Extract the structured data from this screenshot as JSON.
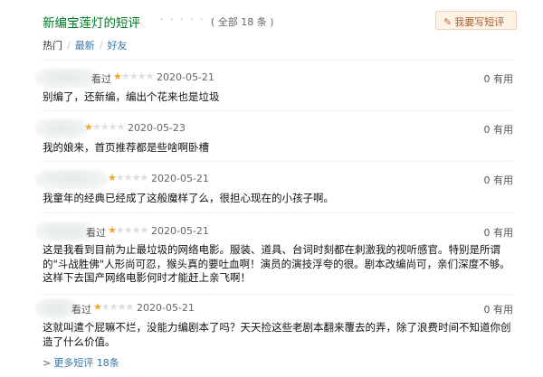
{
  "header": {
    "title": "新编宝莲灯的短评",
    "dots": "· · · · · ·",
    "count": "( 全部 18 条 )",
    "write_button": "我要写短评"
  },
  "filters": {
    "hot": "热门",
    "sep": "/",
    "latest": "最新",
    "friends": "好友"
  },
  "comments": [
    {
      "status": "看过",
      "rating": 1,
      "date": "2020-05-21",
      "useful": "0 有用",
      "text": "别编了，还新编，编出个花来也是垃圾"
    },
    {
      "status": "",
      "rating": 1,
      "date": "2020-05-23",
      "useful": "0 有用",
      "text": "我的娘来，首页推荐都是些啥啊卧槽"
    },
    {
      "status": "",
      "rating": 1,
      "date": "2020-05-21",
      "useful": "0 有用",
      "text": "我童年的经典已经成了这般魔样了么，很担心现在的小孩子啊。"
    },
    {
      "status": "看过",
      "rating": 1,
      "date": "2020-05-21",
      "useful": "0 有用",
      "text": "这是我看到目前为止最垃圾的网络电影。服装、道具、台词时刻都在刺激我的视听感官。特别是所谓的\"斗战胜佛\"人形尚可忍，猴头真的要吐血啊！演员的演技浮夸的很。剧本改编尚可，亲们深度不够。这样下去国产网络电影何时才能赶上亲飞啊！"
    },
    {
      "status": "看过",
      "rating": 1,
      "date": "2020-05-21",
      "useful": "0 有用",
      "text": "这就叫遣个屁嘛不烂，没能力编剧本了吗？天天捡这些老剧本翻来覆去的弄，除了浪费时间不知道你创造了什么价值。"
    }
  ],
  "more_link": "更多短评 18条",
  "colors": {
    "title": "#007722",
    "link": "#3377aa",
    "star": "#f5a623",
    "button_bg": "#fff3e6"
  }
}
